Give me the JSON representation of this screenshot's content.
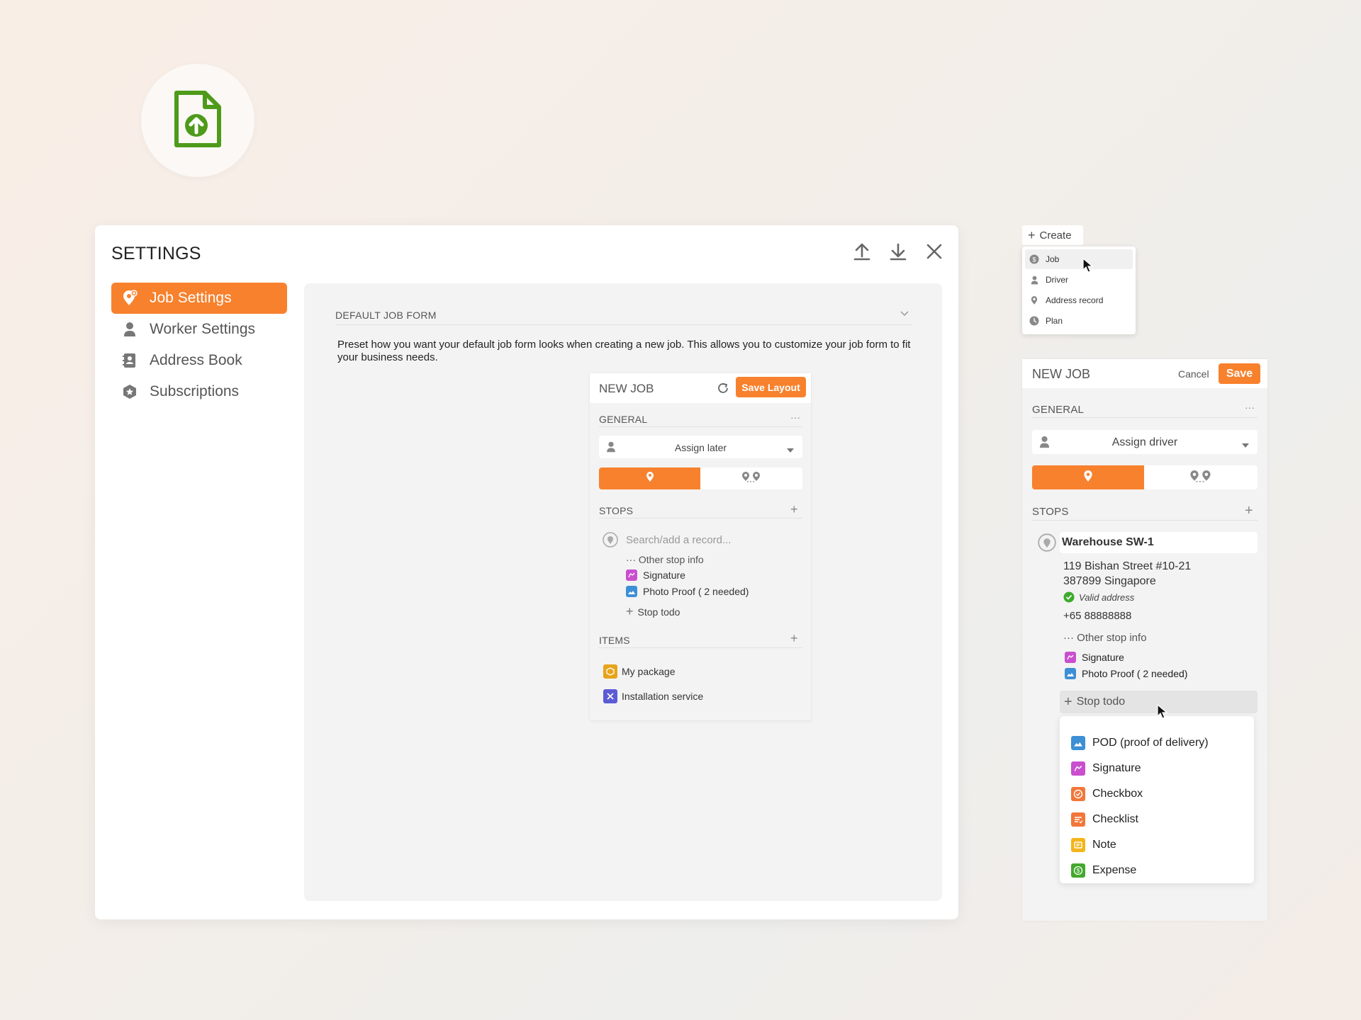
{
  "colors": {
    "accent": "#f8812d",
    "app_icon_green": "#4e9a1a",
    "valid_green": "#3dab2b",
    "signature_pink": "#c94fcf",
    "photo_blue": "#3d8fd6",
    "package_amber": "#e7a41b",
    "install_purple": "#5b5bd6"
  },
  "app_icon": {
    "icon": "file-upload-icon"
  },
  "settings": {
    "title": "SETTINGS",
    "header_actions": [
      {
        "icon": "upload-icon"
      },
      {
        "icon": "download-icon"
      },
      {
        "icon": "close-icon"
      }
    ],
    "nav": [
      {
        "label": "Job Settings",
        "icon": "job-pin-icon",
        "active": true
      },
      {
        "label": "Worker Settings",
        "icon": "person-icon",
        "active": false
      },
      {
        "label": "Address Book",
        "icon": "contact-book-icon",
        "active": false
      },
      {
        "label": "Subscriptions",
        "icon": "badge-star-icon",
        "active": false
      }
    ],
    "section": {
      "title": "DEFAULT JOB FORM",
      "description": "Preset how you want your default job form looks when creating a new job. This allows you to customize your job form to fit your business needs."
    },
    "preview": {
      "title": "NEW JOB",
      "save_label": "Save Layout",
      "general_label": "GENERAL",
      "more_label": "···",
      "assign_label": "Assign later",
      "stops_label": "STOPS",
      "search_placeholder": "Search/add a record...",
      "other_info_label": "··· Other stop info",
      "todos": [
        {
          "label": "Signature",
          "icon": "signature-icon"
        },
        {
          "label": "Photo Proof ( 2 needed)",
          "icon": "photo-icon"
        }
      ],
      "stop_todo_label": "Stop todo",
      "items_label": "ITEMS",
      "items": [
        {
          "label": "My package",
          "icon": "package-icon"
        },
        {
          "label": "Installation service",
          "icon": "tools-icon"
        }
      ]
    }
  },
  "create": {
    "label": "Create",
    "menu": [
      {
        "label": "Job",
        "icon": "dollar-circle-icon"
      },
      {
        "label": "Driver",
        "icon": "person-icon"
      },
      {
        "label": "Address record",
        "icon": "pin-icon"
      },
      {
        "label": "Plan",
        "icon": "clock-icon"
      }
    ]
  },
  "new_job": {
    "title": "NEW JOB",
    "cancel_label": "Cancel",
    "save_label": "Save",
    "general_label": "GENERAL",
    "more_label": "···",
    "assign_label": "Assign driver",
    "stops_label": "STOPS",
    "stop": {
      "name": "Warehouse SW-1",
      "address_line1": "119 Bishan Street #10-21",
      "address_line2": "387899 Singapore",
      "valid_label": "Valid address",
      "phone": "+65 88888888"
    },
    "other_info_label": "··· Other stop info",
    "todos": [
      {
        "label": "Signature",
        "icon": "signature-icon"
      },
      {
        "label": "Photo Proof ( 2 needed)",
        "icon": "photo-icon"
      }
    ],
    "stop_todo_label": "Stop todo",
    "todo_menu": [
      {
        "label": "POD (proof of delivery)",
        "icon": "photo-icon",
        "color": "#3d8fd6"
      },
      {
        "label": "Signature",
        "icon": "signature-icon",
        "color": "#c94fcf"
      },
      {
        "label": "Checkbox",
        "icon": "checkbox-icon",
        "color": "#f2773a"
      },
      {
        "label": "Checklist",
        "icon": "checklist-icon",
        "color": "#f2773a"
      },
      {
        "label": "Note",
        "icon": "note-icon",
        "color": "#f3b51b"
      },
      {
        "label": "Expense",
        "icon": "expense-icon",
        "color": "#44a82e"
      }
    ]
  }
}
